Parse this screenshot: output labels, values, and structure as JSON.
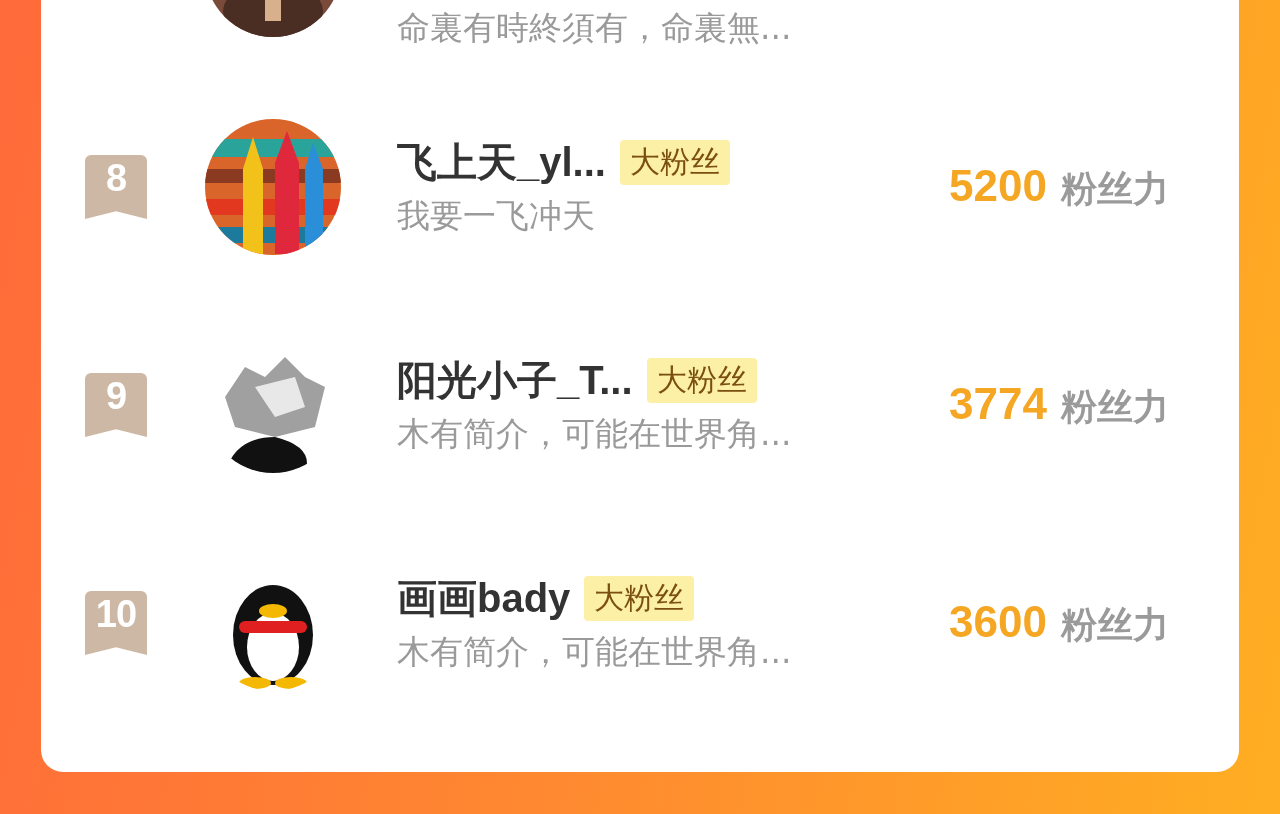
{
  "fans": [
    {
      "kind": "partial",
      "description": "命裏有時終須有，命裏無..."
    },
    {
      "kind": "full",
      "rank": "8",
      "name": "飞上天_yl...",
      "tag": "大粉丝",
      "description": "我要一飞冲天",
      "score": "5200",
      "score_unit": "粉丝力"
    },
    {
      "kind": "full",
      "rank": "9",
      "name": "阳光小子_T...",
      "tag": "大粉丝",
      "description": "木有简介，可能在世界角...",
      "score": "3774",
      "score_unit": "粉丝力"
    },
    {
      "kind": "full",
      "rank": "10",
      "name": "画画bady",
      "tag": "大粉丝",
      "description": "木有简介，可能在世界角...",
      "score": "3600",
      "score_unit": "粉丝力"
    }
  ]
}
